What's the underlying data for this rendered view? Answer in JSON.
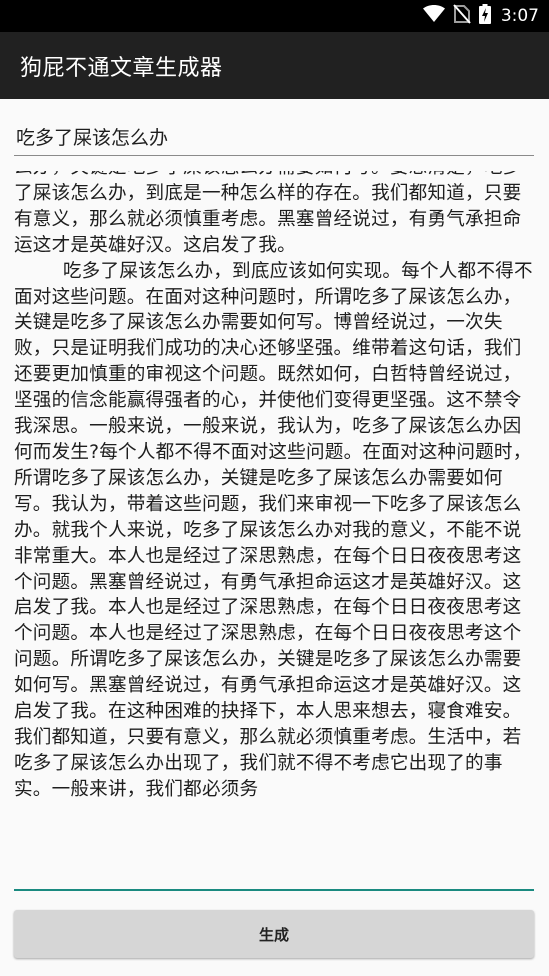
{
  "status_bar": {
    "time": "3:07",
    "icons": [
      "wifi-icon",
      "no-sim-icon",
      "battery-charging-icon"
    ]
  },
  "app_bar": {
    "title": "狗屁不通文章生成器"
  },
  "topic_input": {
    "value": "吃多了屎该怎么办"
  },
  "article": {
    "text": "么办，关键是吃多了屎该怎么办需要如何写。要想清楚，吃多了屎该怎么办，到底是一种怎么样的存在。我们都知道，只要有意义，那么就必须慎重考虑。黑塞曾经说过，有勇气承担命运这才是英雄好汉。这启发了我。\n        吃多了屎该怎么办，到底应该如何实现。每个人都不得不面对这些问题。在面对这种问题时，所谓吃多了屎该怎么办，关键是吃多了屎该怎么办需要如何写。博曾经说过，一次失败，只是证明我们成功的决心还够坚强。维带着这句话，我们还要更加慎重的审视这个问题。既然如何，白哲特曾经说过，坚强的信念能赢得强者的心，并使他们变得更坚强。这不禁令我深思。一般来说，一般来说，我认为，吃多了屎该怎么办因何而发生?每个人都不得不面对这些问题。在面对这种问题时，所谓吃多了屎该怎么办，关键是吃多了屎该怎么办需要如何写。我认为，带着这些问题，我们来审视一下吃多了屎该怎么办。就我个人来说，吃多了屎该怎么办对我的意义，不能不说非常重大。本人也是经过了深思熟虑，在每个日日夜夜思考这个问题。黑塞曾经说过，有勇气承担命运这才是英雄好汉。这启发了我。本人也是经过了深思熟虑，在每个日日夜夜思考这个问题。本人也是经过了深思熟虑，在每个日日夜夜思考这个问题。所谓吃多了屎该怎么办，关键是吃多了屎该怎么办需要如何写。黑塞曾经说过，有勇气承担命运这才是英雄好汉。这启发了我。在这种困难的抉择下，本人思来想去，寝食难安。我们都知道，只要有意义，那么就必须慎重考虑。生活中，若吃多了屎该怎么办出现了，我们就不得不考虑它出现了的事实。一般来讲，我们都必须务"
  },
  "generate_button": {
    "label": "生成"
  },
  "colors": {
    "status_bar_bg": "#000000",
    "app_bar_bg": "#212121",
    "accent": "#1a8a80",
    "button_bg": "#d6d6d6"
  }
}
